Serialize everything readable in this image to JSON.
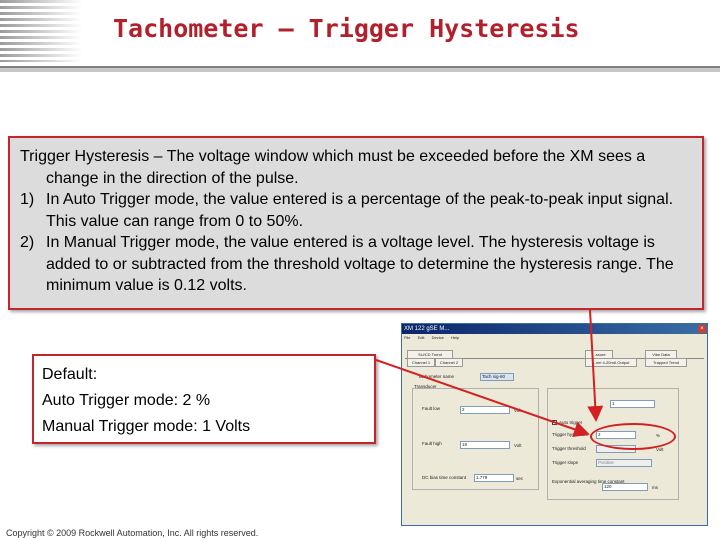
{
  "slide": {
    "title": "Tachometer – Trigger Hysteresis",
    "copyright": "Copyright © 2009 Rockwell Automation, Inc. All rights reserved."
  },
  "description": {
    "intro": "Trigger Hysteresis – The voltage window which must be exceeded before the XM sees a change in the direction of the pulse.",
    "items": [
      {
        "num": "1)",
        "text": "In Auto Trigger mode, the value entered is a percentage of the peak-to-peak input signal. This value can range from 0 to 50%."
      },
      {
        "num": "2)",
        "text": "In Manual Trigger mode, the value entered is a voltage level. The hysteresis voltage is added to or subtracted from the threshold voltage to determine the hysteresis range. The minimum value is 0.12 volts."
      }
    ]
  },
  "defaults": {
    "heading": "Default:",
    "auto": "Auto Trigger mode: 2 %",
    "manual": "Manual Trigger mode: 1 Volts"
  },
  "screenshot": {
    "window_title": "XM 122 gSE M...",
    "menu": [
      "File",
      "Edit",
      "Device",
      "Help"
    ],
    "tabs": [
      "SU/CD Trend",
      "Channel 1",
      "Channel 2",
      "...ssure",
      "...nel 4-20mA Output",
      "Vibe Data",
      "Trapped Trend"
    ],
    "tach_name_label": "Tachometer name",
    "tach_name_value": "Tach sig-60",
    "transducer_label": "Transducer",
    "fault_low_label": "Fault low",
    "fault_low_value": "2",
    "fault_high_label": "Fault high",
    "fault_high_value": "18",
    "dc_bias_label": "DC bias time constant",
    "dc_bias_value": "1.779",
    "unit_volt": "Volt",
    "unit_sec": "sec",
    "pulses_value": "1",
    "auto_trigger_label": "Auto trigger",
    "hysteresis_label": "Trigger hysteresis",
    "hysteresis_value": "2",
    "hysteresis_unit": "%",
    "threshold_label": "Trigger threshold",
    "trigger_slope_label": "Trigger slope",
    "trigger_slope_value": "Positive",
    "exp_avg_label": "Exponential averaging time constant",
    "exp_avg_value": "120",
    "unit_ms": "ms"
  },
  "colors": {
    "title": "#b2202c",
    "box_border": "#c0262b",
    "box_fill": "#dcdcdc"
  }
}
